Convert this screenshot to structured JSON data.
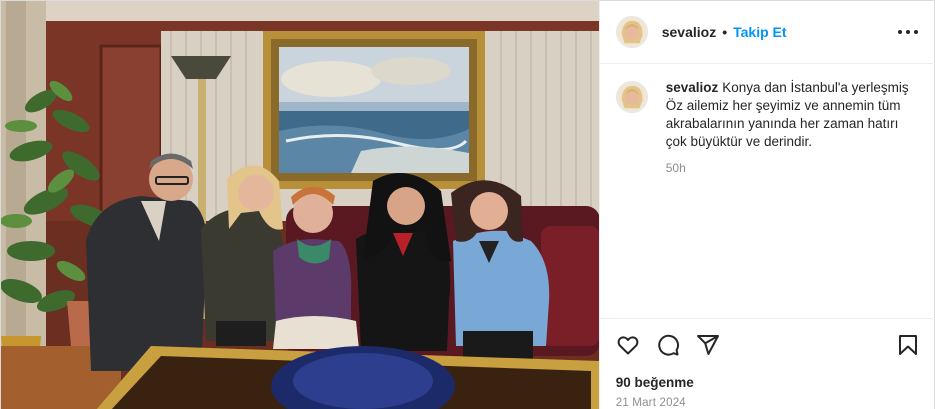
{
  "post": {
    "username": "sevalioz",
    "separator": "•",
    "follow_label": "Takip Et",
    "more_icon": "more-horizontal-icon",
    "caption": {
      "username": "sevalioz",
      "text": "Konya dan İstanbul'a yerleşmiş Öz ailemiz her şeyimiz ve annemin tüm akrabalarının yanında her zaman hatırı çok büyüktür ve derindir.",
      "time": "50h"
    },
    "actions": {
      "like_icon": "heart-icon",
      "comment_icon": "comment-icon",
      "share_icon": "send-icon",
      "save_icon": "bookmark-icon"
    },
    "likes": "90 beğenme",
    "date": "21 Mart 2024"
  },
  "colors": {
    "link_blue": "#0095f6",
    "text_dark": "#262626",
    "text_muted": "#8e8e8e",
    "border": "#efefef"
  }
}
